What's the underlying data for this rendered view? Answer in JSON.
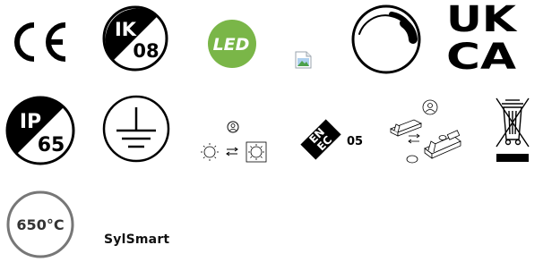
{
  "icons": {
    "ce": {
      "label": "CE",
      "icon": "ce-mark-icon"
    },
    "ik08": {
      "top": "IK",
      "bottom": "08",
      "icon": "ik-rating-icon"
    },
    "led": {
      "label": "LED",
      "color": "#7ab648",
      "icon": "led-icon"
    },
    "broken": {
      "icon": "broken-image-icon"
    },
    "dimmable": {
      "icon": "dimmable-icon"
    },
    "ukca": {
      "line1": "UK",
      "line2": "CA",
      "icon": "ukca-mark-icon"
    },
    "ip65": {
      "top": "IP",
      "bottom": "65",
      "icon": "ip-rating-icon"
    },
    "earth": {
      "icon": "protective-earth-icon"
    },
    "sensor_switch": {
      "icon": "sensor-switch-icon"
    },
    "enec": {
      "top": "EN",
      "bottom": "EC",
      "number": "05",
      "icon": "enec-mark-icon"
    },
    "sensor_module": {
      "icon": "sensor-module-icon"
    },
    "weee": {
      "icon": "weee-bin-icon"
    },
    "glow_wire": {
      "label": "650°C",
      "icon": "glow-wire-icon"
    },
    "sylsmart": {
      "label": "SylSmart"
    }
  }
}
